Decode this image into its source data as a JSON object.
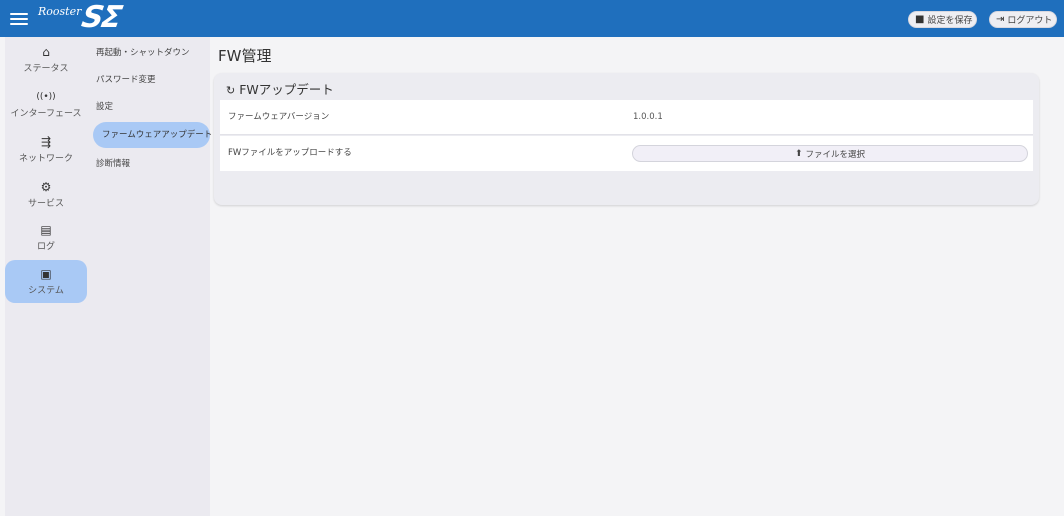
{
  "header": {
    "logo_text": "Rooster",
    "logo_mark": "SΣ",
    "save_label": "設定を保存",
    "logout_label": "ログアウト",
    "save_icon": "floppy-icon",
    "logout_icon": "logout-icon"
  },
  "rail": {
    "items": [
      {
        "label": "ステータス",
        "icon": "home-icon",
        "glyph": "⌂"
      },
      {
        "label": "インターフェース",
        "icon": "antenna-icon",
        "glyph": "((•))"
      },
      {
        "label": "ネットワーク",
        "icon": "network-icon",
        "glyph": "⇶"
      },
      {
        "label": "サービス",
        "icon": "gears-icon",
        "glyph": "⚙"
      },
      {
        "label": "ログ",
        "icon": "log-icon",
        "glyph": "▤"
      },
      {
        "label": "システム",
        "icon": "system-icon",
        "glyph": "▣"
      }
    ],
    "active_index": 5
  },
  "subnav": {
    "items": [
      "再起動・シャットダウン",
      "パスワード変更",
      "設定",
      "ファームウェアアップデート",
      "診断情報"
    ],
    "active_index": 3
  },
  "page": {
    "title": "FW管理",
    "card_title": "FWアップデート",
    "card_icon": "refresh-icon",
    "rows": [
      {
        "label": "ファームウェアバージョン",
        "value": "1.0.0.1"
      },
      {
        "label": "FWファイルをアップロードする",
        "button": "ファイルを選択",
        "button_icon": "upload-icon"
      }
    ]
  },
  "colors": {
    "topbar": "#1f6fbd",
    "active": "#a9c9f5"
  }
}
